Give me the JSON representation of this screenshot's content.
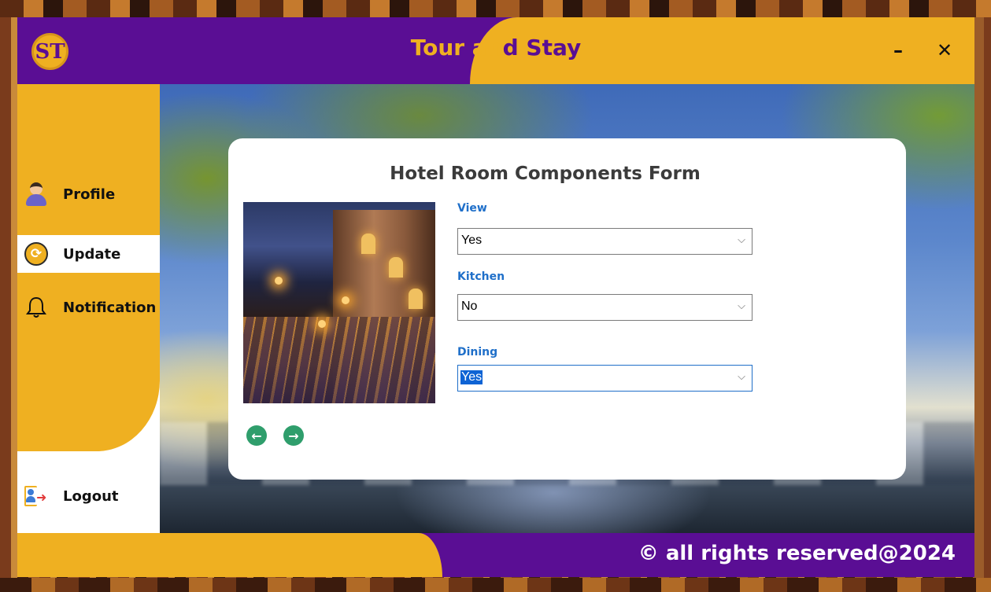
{
  "window": {
    "app_title_part1": "Tour an",
    "app_title_part2": "d Stay",
    "logo_text": "ST",
    "minimize_label": "–",
    "close_label": "✕"
  },
  "sidebar": {
    "items": [
      {
        "label": "Profile",
        "icon": "avatar-icon",
        "active": false
      },
      {
        "label": "Update",
        "icon": "update-icon",
        "active": true
      },
      {
        "label": "Notification",
        "icon": "bell-icon",
        "active": false
      }
    ],
    "logout_label": "Logout"
  },
  "form": {
    "title": "Hotel Room Components Form",
    "fields": [
      {
        "label": "View",
        "value": "Yes"
      },
      {
        "label": "Kitchen",
        "value": "No"
      },
      {
        "label": "Dining",
        "value": "Yes"
      }
    ],
    "prev_icon": "←",
    "next_icon": "→"
  },
  "footer": {
    "text": "© all rights reserved@2024"
  },
  "colors": {
    "purple": "#5a0e94",
    "gold": "#efb021",
    "label_blue": "#1f6fc9",
    "arrow_green": "#2f9e6c",
    "selection_blue": "#0e63d4"
  }
}
